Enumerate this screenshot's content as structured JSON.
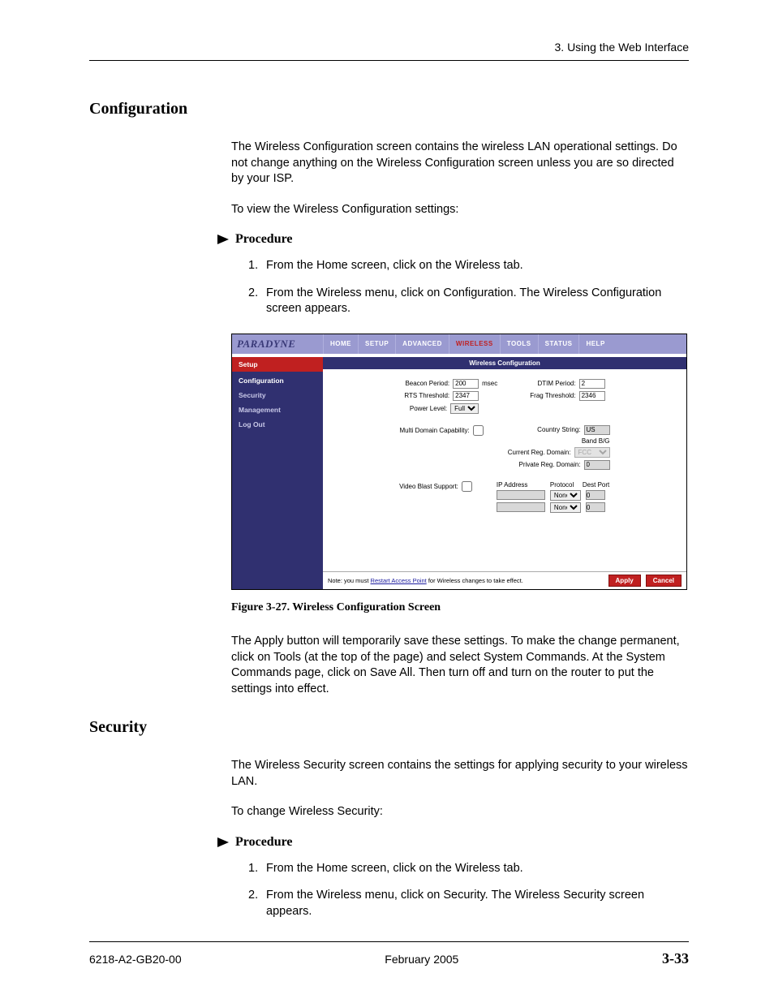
{
  "header": {
    "running": "3. Using the Web Interface"
  },
  "section_configuration": {
    "title": "Configuration",
    "intro": "The Wireless Configuration screen contains the wireless LAN operational settings. Do not change anything on the Wireless Configuration screen unless you are so directed by your ISP.",
    "lead": "To view the Wireless Configuration settings:",
    "procedure_label": "Procedure",
    "steps": [
      "From the Home screen, click on the Wireless tab.",
      "From the Wireless menu, click on Configuration. The Wireless Configuration screen appears."
    ],
    "after_figure": "The Apply button will temporarily save these settings. To make the change permanent, click on Tools (at the top of the page) and select System Commands. At the System Commands page, click on Save All. Then turn off and turn on the router to put the settings into effect."
  },
  "figure": {
    "caption": "Figure 3-27.   Wireless Configuration Screen",
    "brand": "PARADYNE",
    "tabs": [
      "HOME",
      "SETUP",
      "ADVANCED",
      "WIRELESS",
      "TOOLS",
      "STATUS",
      "HELP"
    ],
    "active_tab": "WIRELESS",
    "sidebar": {
      "head": "Setup",
      "items": [
        "Configuration",
        "Security",
        "Management",
        "Log Out"
      ],
      "current": "Configuration"
    },
    "panel_title": "Wireless Configuration",
    "fields": {
      "beacon_label": "Beacon Period:",
      "beacon_value": "200",
      "beacon_unit": "msec",
      "dtim_label": "DTIM Period:",
      "dtim_value": "2",
      "rts_label": "RTS Threshold:",
      "rts_value": "2347",
      "frag_label": "Frag Threshold:",
      "frag_value": "2346",
      "power_label": "Power Level:",
      "power_value": "Full",
      "mdc_label": "Multi Domain Capability:",
      "country_label": "Country String:",
      "country_value": "US",
      "band_label": "Band B/G",
      "crd_label": "Current Reg. Domain:",
      "crd_value": "FCC",
      "prd_label": "Private Reg. Domain:",
      "prd_value": "0",
      "vbs_label": "Video Blast Support:",
      "ip_header_ip": "IP Address",
      "ip_header_proto": "Protocol",
      "ip_header_port": "Dest Port",
      "proto_value": "None",
      "port_value": "0"
    },
    "footer": {
      "note_pre": "Note: you must ",
      "note_link": "Restart Access Point",
      "note_post": " for Wireless changes to take effect.",
      "apply": "Apply",
      "cancel": "Cancel"
    }
  },
  "section_security": {
    "title": "Security",
    "intro": "The Wireless Security screen contains the settings for applying security to your wireless LAN.",
    "lead": "To change Wireless Security:",
    "procedure_label": "Procedure",
    "steps": [
      "From the Home screen, click on the Wireless tab.",
      "From the Wireless menu, click on Security. The Wireless Security screen appears."
    ]
  },
  "footer": {
    "left": "6218-A2-GB20-00",
    "center": "February 2005",
    "right": "3-33"
  }
}
